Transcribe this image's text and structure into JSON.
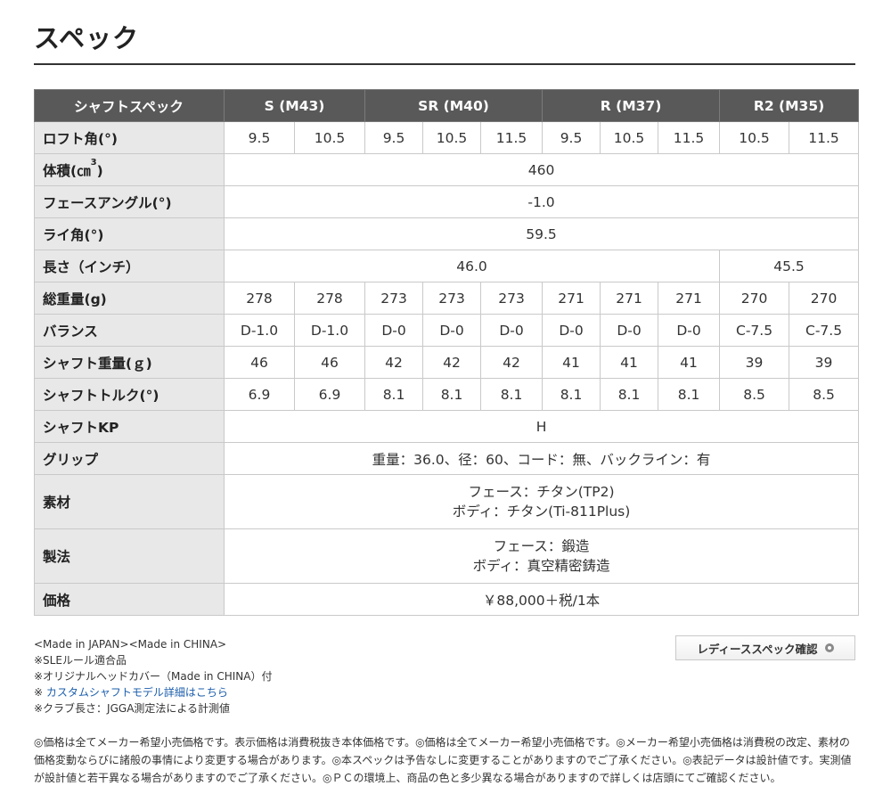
{
  "title": "スペック",
  "table": {
    "header": {
      "label": "シャフトスペック",
      "groups": [
        "S (M43)",
        "SR (M40)",
        "R (M37)",
        "R2 (M35)"
      ]
    },
    "rows": {
      "loft": {
        "label": "ロフト角(°)",
        "values": [
          "9.5",
          "10.5",
          "9.5",
          "10.5",
          "11.5",
          "9.5",
          "10.5",
          "11.5",
          "10.5",
          "11.5"
        ]
      },
      "volume": {
        "label": "体積(㎝",
        "label_sup": "3",
        "label_end": ")",
        "value": "460"
      },
      "face_angle": {
        "label": "フェースアングル(°)",
        "value": "-1.0"
      },
      "lie": {
        "label": "ライ角(°)",
        "value": "59.5"
      },
      "length": {
        "label": "長さ（インチ）",
        "value_main": "46.0",
        "value_r2": "45.5"
      },
      "weight": {
        "label": "総重量(g)",
        "values": [
          "278",
          "278",
          "273",
          "273",
          "273",
          "271",
          "271",
          "271",
          "270",
          "270"
        ]
      },
      "balance": {
        "label": "バランス",
        "values": [
          "D-1.0",
          "D-1.0",
          "D-0",
          "D-0",
          "D-0",
          "D-0",
          "D-0",
          "D-0",
          "C-7.5",
          "C-7.5"
        ]
      },
      "shaft_weight": {
        "label": "シャフト重量(ｇ)",
        "values": [
          "46",
          "46",
          "42",
          "42",
          "42",
          "41",
          "41",
          "41",
          "39",
          "39"
        ]
      },
      "shaft_torque": {
        "label": "シャフトトルク(°)",
        "values": [
          "6.9",
          "6.9",
          "8.1",
          "8.1",
          "8.1",
          "8.1",
          "8.1",
          "8.1",
          "8.5",
          "8.5"
        ]
      },
      "shaft_kp": {
        "label": "シャフトKP",
        "value": "H"
      },
      "grip": {
        "label": "グリップ",
        "value": "重量：36.0、径：60、コード：無、バックライン：有"
      },
      "material": {
        "label": "素材",
        "line1": "フェース：チタン(TP2)",
        "line2": "ボディ：チタン(Ti-811Plus)"
      },
      "manufacturing": {
        "label": "製法",
        "line1": "フェース：鍛造",
        "line2": "ボディ：真空精密鋳造"
      },
      "price": {
        "label": "価格",
        "value": "￥88,000＋税/1本"
      }
    }
  },
  "notes": {
    "line1": "<Made in JAPAN><Made in CHINA>",
    "line2": "※SLEルール適合品",
    "line3": "※オリジナルヘッドカバー（Made in CHINA）付",
    "line4_prefix": "※ ",
    "line4_link": "カスタムシャフトモデル詳細はこちら",
    "line5": "※クラブ長さ：JGGA測定法による計測値"
  },
  "ladies_button": {
    "label": "レディーススペック確認",
    "icon": "circle-arrow-icon"
  },
  "disclaimer": "◎価格は全てメーカー希望小売価格です。表示価格は消費税抜き本体価格です。◎価格は全てメーカー希望小売価格です。◎メーカー希望小売価格は消費税の改定、素材の価格変動ならびに諸般の事情により変更する場合があります。◎本スペックは予告なしに変更することがありますのでご了承ください。◎表記データは設計値です。実測値が設計値と若干異なる場合がありますのでご了承ください。◎ＰＣの環境上、商品の色と多少異なる場合がありますので詳しくは店頭にてご確認ください。",
  "colors": {
    "header_bg": "#595959",
    "label_bg": "#e8e8e8",
    "link": "#1a5dab"
  }
}
